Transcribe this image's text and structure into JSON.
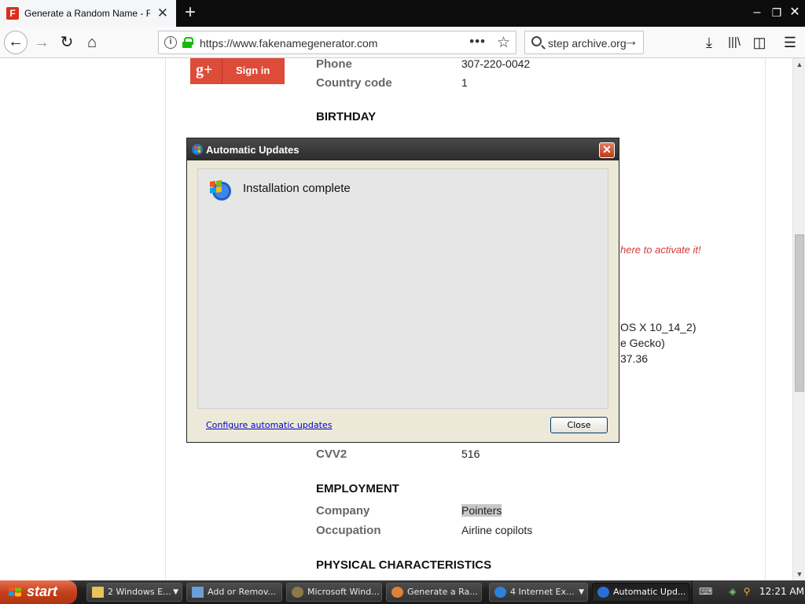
{
  "browser": {
    "tab_title": "Generate a Random Name - Fake Name Generator",
    "tab_favicon_letter": "F",
    "url": "https://www.fakenamegenerator.com",
    "search_query": "step archive.org"
  },
  "page": {
    "social_button": "Sign in",
    "social_icon": "g+",
    "rows": [
      {
        "label": "Phone",
        "value": "307-220-0042"
      },
      {
        "label": "Country code",
        "value": "1"
      }
    ],
    "section_birthday": "BIRTHDAY",
    "peek_activate": "here to activate it!",
    "peek_ua_1": "OS X 10_14_2)",
    "peek_ua_2": "e Gecko)",
    "peek_ua_3": "37.36",
    "cvv_label": "CVV2",
    "cvv_value": "516",
    "section_employment": "EMPLOYMENT",
    "company_label": "Company",
    "company_value": "Pointers",
    "occupation_label": "Occupation",
    "occupation_value": "Airline copilots",
    "section_physical": "PHYSICAL CHARACTERISTICS"
  },
  "dialog": {
    "title": "Automatic Updates",
    "message": "Installation complete",
    "link": "Configure automatic updates",
    "close_button": "Close"
  },
  "taskbar": {
    "start_label": "start",
    "tasks": [
      {
        "label": "2 Windows E...",
        "icon": "folder-icon",
        "group": true
      },
      {
        "label": "Add or Remov...",
        "icon": "add-remove-icon",
        "group": false
      },
      {
        "label": "Microsoft Wind...",
        "icon": "windows-update-icon",
        "group": false
      },
      {
        "label": "Generate a Ra...",
        "icon": "firefox-icon",
        "group": false
      },
      {
        "label": "4 Internet Ex...",
        "icon": "ie-icon",
        "group": true
      },
      {
        "label": "Automatic Upd...",
        "icon": "windows-update-icon",
        "group": false
      }
    ],
    "clock": "12:21 AM"
  },
  "colors": {
    "gplus_red": "#dd4b39",
    "dialog_close_red": "#c13a18",
    "link_blue": "#0000cc",
    "secure_green": "#12bc00"
  }
}
